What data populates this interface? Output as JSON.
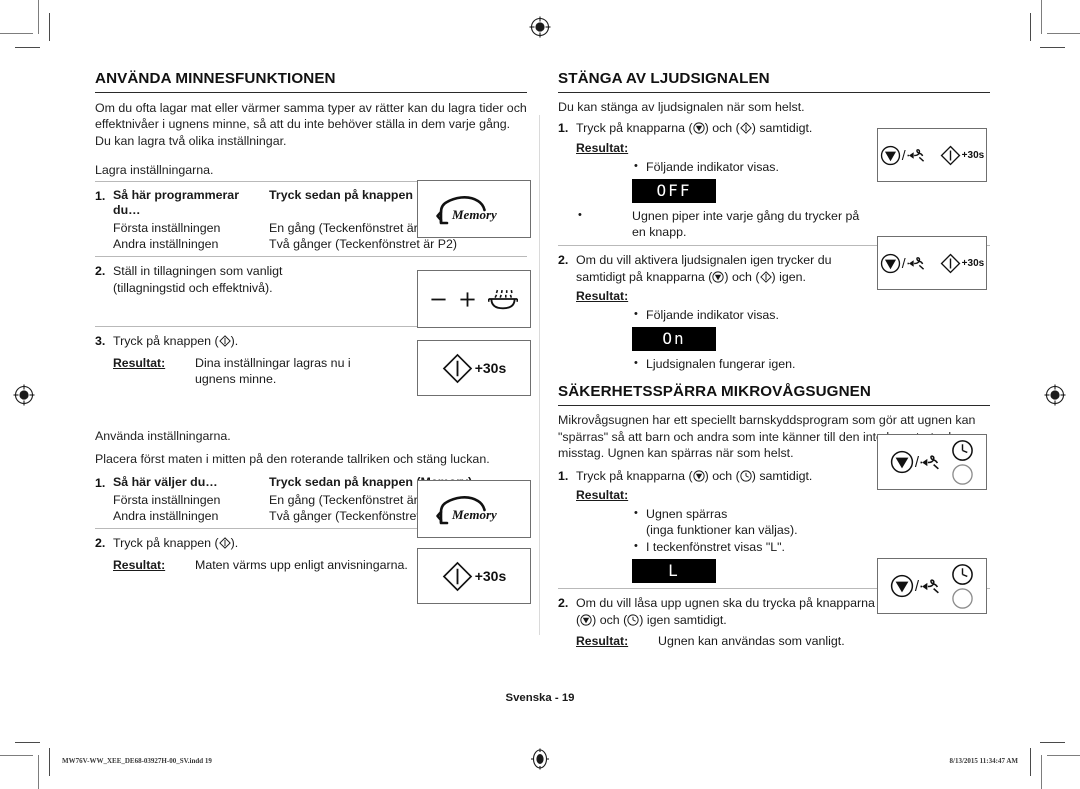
{
  "document": {
    "language": "Svenska",
    "folio": "Svenska - 19",
    "imprint_file": "MW76V-WW_XEE_DE68-03927H-00_SV.indd   19",
    "imprint_timestamp": "8/13/2015   11:34:47 AM"
  },
  "left_column": {
    "section_title": "ANVÄNDA MINNESFUNKTIONEN",
    "intro": "Om du ofta lagar mat eller värmer samma typer av rätter kan du lagra tider och effektnivåer i ugnens minne, så att du inte behöver ställa in dem varje gång. Du kan lagra två olika inställningar.",
    "store_lead": "Lagra inställningarna.",
    "step1": {
      "num": "1.",
      "col1_header": "Så här programmerar du…",
      "col2_header": "Tryck sedan på knappen (Memory)…",
      "rows": [
        {
          "c1": "Första inställningen",
          "c2": "En gång (Teckenfönstret är P1)"
        },
        {
          "c1": "Andra inställningen",
          "c2": "Två gånger (Teckenfönstret är P2)"
        }
      ],
      "icon_label": "Memory"
    },
    "step2": {
      "num": "2.",
      "text": "Ställ in tillagningen som vanligt (tillagningstid och effektnivå)."
    },
    "step3": {
      "num": "3.",
      "text": "Tryck på knappen (Start).",
      "result_label": "Resultat:",
      "result_text": "Dina inställningar lagras nu i ugnens minne.",
      "icon_label": "+30s"
    },
    "use_lead": "Använda inställningarna.",
    "use_instruction": "Placera först maten i mitten på den roterande tallriken och stäng luckan.",
    "step4": {
      "num": "1.",
      "col1_header": "Så här väljer du…",
      "col2_header": "Tryck sedan på knappen (Memory)…",
      "rows": [
        {
          "c1": "Första inställningen",
          "c2": "En gång (Teckenfönstret är P1)"
        },
        {
          "c1": "Andra inställningen",
          "c2": "Två gånger (Teckenfönstret är P2)"
        }
      ],
      "icon_label": "Memory"
    },
    "step5": {
      "num": "2.",
      "text": "Tryck på knappen (Start).",
      "result_label": "Resultat:",
      "result_text": "Maten värms upp enligt anvisningarna.",
      "icon_label": "+30s"
    }
  },
  "right_column": {
    "sound_section": {
      "title": "STÄNGA AV LJUDSIGNALEN",
      "intro": "Du kan stänga av ljudsignalen när som helst.",
      "step1": {
        "num": "1.",
        "text": "Tryck på knapparna (Stop) och (Start) samtidigt.",
        "result_label": "Resultat:",
        "bullet1": "Följande indikator visas.",
        "display": "OFF",
        "bullet2": "Ugnen piper inte varje gång du trycker på en knapp.",
        "icon_label": "+30s"
      },
      "step2": {
        "num": "2.",
        "text": "Om du vill aktivera ljudsignalen igen trycker du samtidigt på knapparna (Stop) och (Start) igen.",
        "result_label": "Resultat:",
        "bullet1": "Följande indikator visas.",
        "display": "On",
        "bullet2": "Ljudsignalen fungerar igen.",
        "icon_label": "+30s"
      }
    },
    "lock_section": {
      "title": "SÄKERHETSSPÄRRA MIKROVÅGSUGNEN",
      "intro": "Mikrovågsugnen har ett speciellt barnskyddsprogram som gör att ugnen kan \"spärras\" så att barn och andra som inte känner till den inte kan starta den av misstag. Ugnen kan spärras när som helst.",
      "step1": {
        "num": "1.",
        "text": "Tryck på knapparna (Stop) och (Clock) samtidigt.",
        "result_label": "Resultat:",
        "bullet1_line1": "Ugnen spärras",
        "bullet1_line2": "(inga funktioner kan väljas).",
        "bullet2": "I teckenfönstret visas \"L\".",
        "display": "L"
      },
      "step2": {
        "num": "2.",
        "text": "Om du vill låsa upp ugnen ska du trycka på knapparna (Stop) och (Clock) igen samtidigt.",
        "result_label": "Resultat:",
        "result_text": "Ugnen kan användas som vanligt."
      }
    }
  },
  "icons": {
    "memory": "memory-head-icon",
    "minus": "minus-icon",
    "plus": "plus-icon",
    "steam": "steam-cook-icon",
    "start": "start-diamond-icon",
    "stop": "stop-triangle-icon",
    "cancel": "cancel-plug-icon",
    "clock": "clock-icon",
    "registration": "registration-target-icon"
  },
  "colors": {
    "ink": "#1a1a1a",
    "rule": "#b9b9b9",
    "box_border": "#6f6f6f",
    "lcd_bg": "#000000",
    "lcd_fg": "#ffffff"
  }
}
